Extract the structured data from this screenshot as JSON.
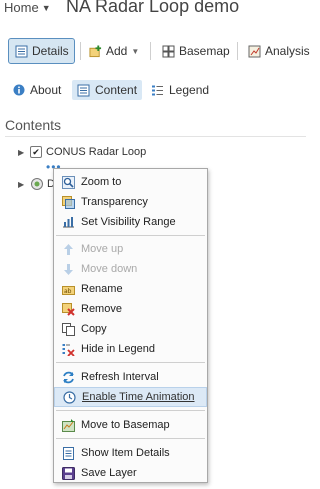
{
  "header": {
    "home_label": "Home",
    "title": "NA Radar Loop demo"
  },
  "toolbar": {
    "details": "Details",
    "add": "Add",
    "basemap": "Basemap",
    "analysis": "Analysis"
  },
  "tabs": {
    "about": "About",
    "content": "Content",
    "legend": "Legend"
  },
  "contents": {
    "heading": "Contents",
    "layers": [
      {
        "label": "CONUS Radar Loop",
        "checked": true
      },
      {
        "label": "Da",
        "checked": false
      }
    ],
    "more_dots": "•••"
  },
  "context_menu": {
    "items": [
      {
        "label": "Zoom to",
        "icon": "zoom-to-icon",
        "disabled": false
      },
      {
        "label": "Transparency",
        "icon": "transparency-icon",
        "disabled": false
      },
      {
        "label": "Set Visibility Range",
        "icon": "visibility-range-icon",
        "disabled": false
      },
      {
        "label": "Move up",
        "icon": "arrow-up-icon",
        "disabled": true
      },
      {
        "label": "Move down",
        "icon": "arrow-down-icon",
        "disabled": true
      },
      {
        "label": "Rename",
        "icon": "rename-icon",
        "disabled": false
      },
      {
        "label": "Remove",
        "icon": "remove-icon",
        "disabled": false
      },
      {
        "label": "Copy",
        "icon": "copy-icon",
        "disabled": false
      },
      {
        "label": "Hide in Legend",
        "icon": "hide-legend-icon",
        "disabled": false
      },
      {
        "label": "Refresh Interval",
        "icon": "refresh-icon",
        "disabled": false
      },
      {
        "label": "Enable Time Animation",
        "icon": "clock-icon",
        "disabled": false,
        "hovered": true
      },
      {
        "label": "Move to Basemap",
        "icon": "basemap-move-icon",
        "disabled": false
      },
      {
        "label": "Show Item Details",
        "icon": "item-details-icon",
        "disabled": false
      },
      {
        "label": "Save Layer",
        "icon": "save-icon",
        "disabled": false
      }
    ]
  }
}
